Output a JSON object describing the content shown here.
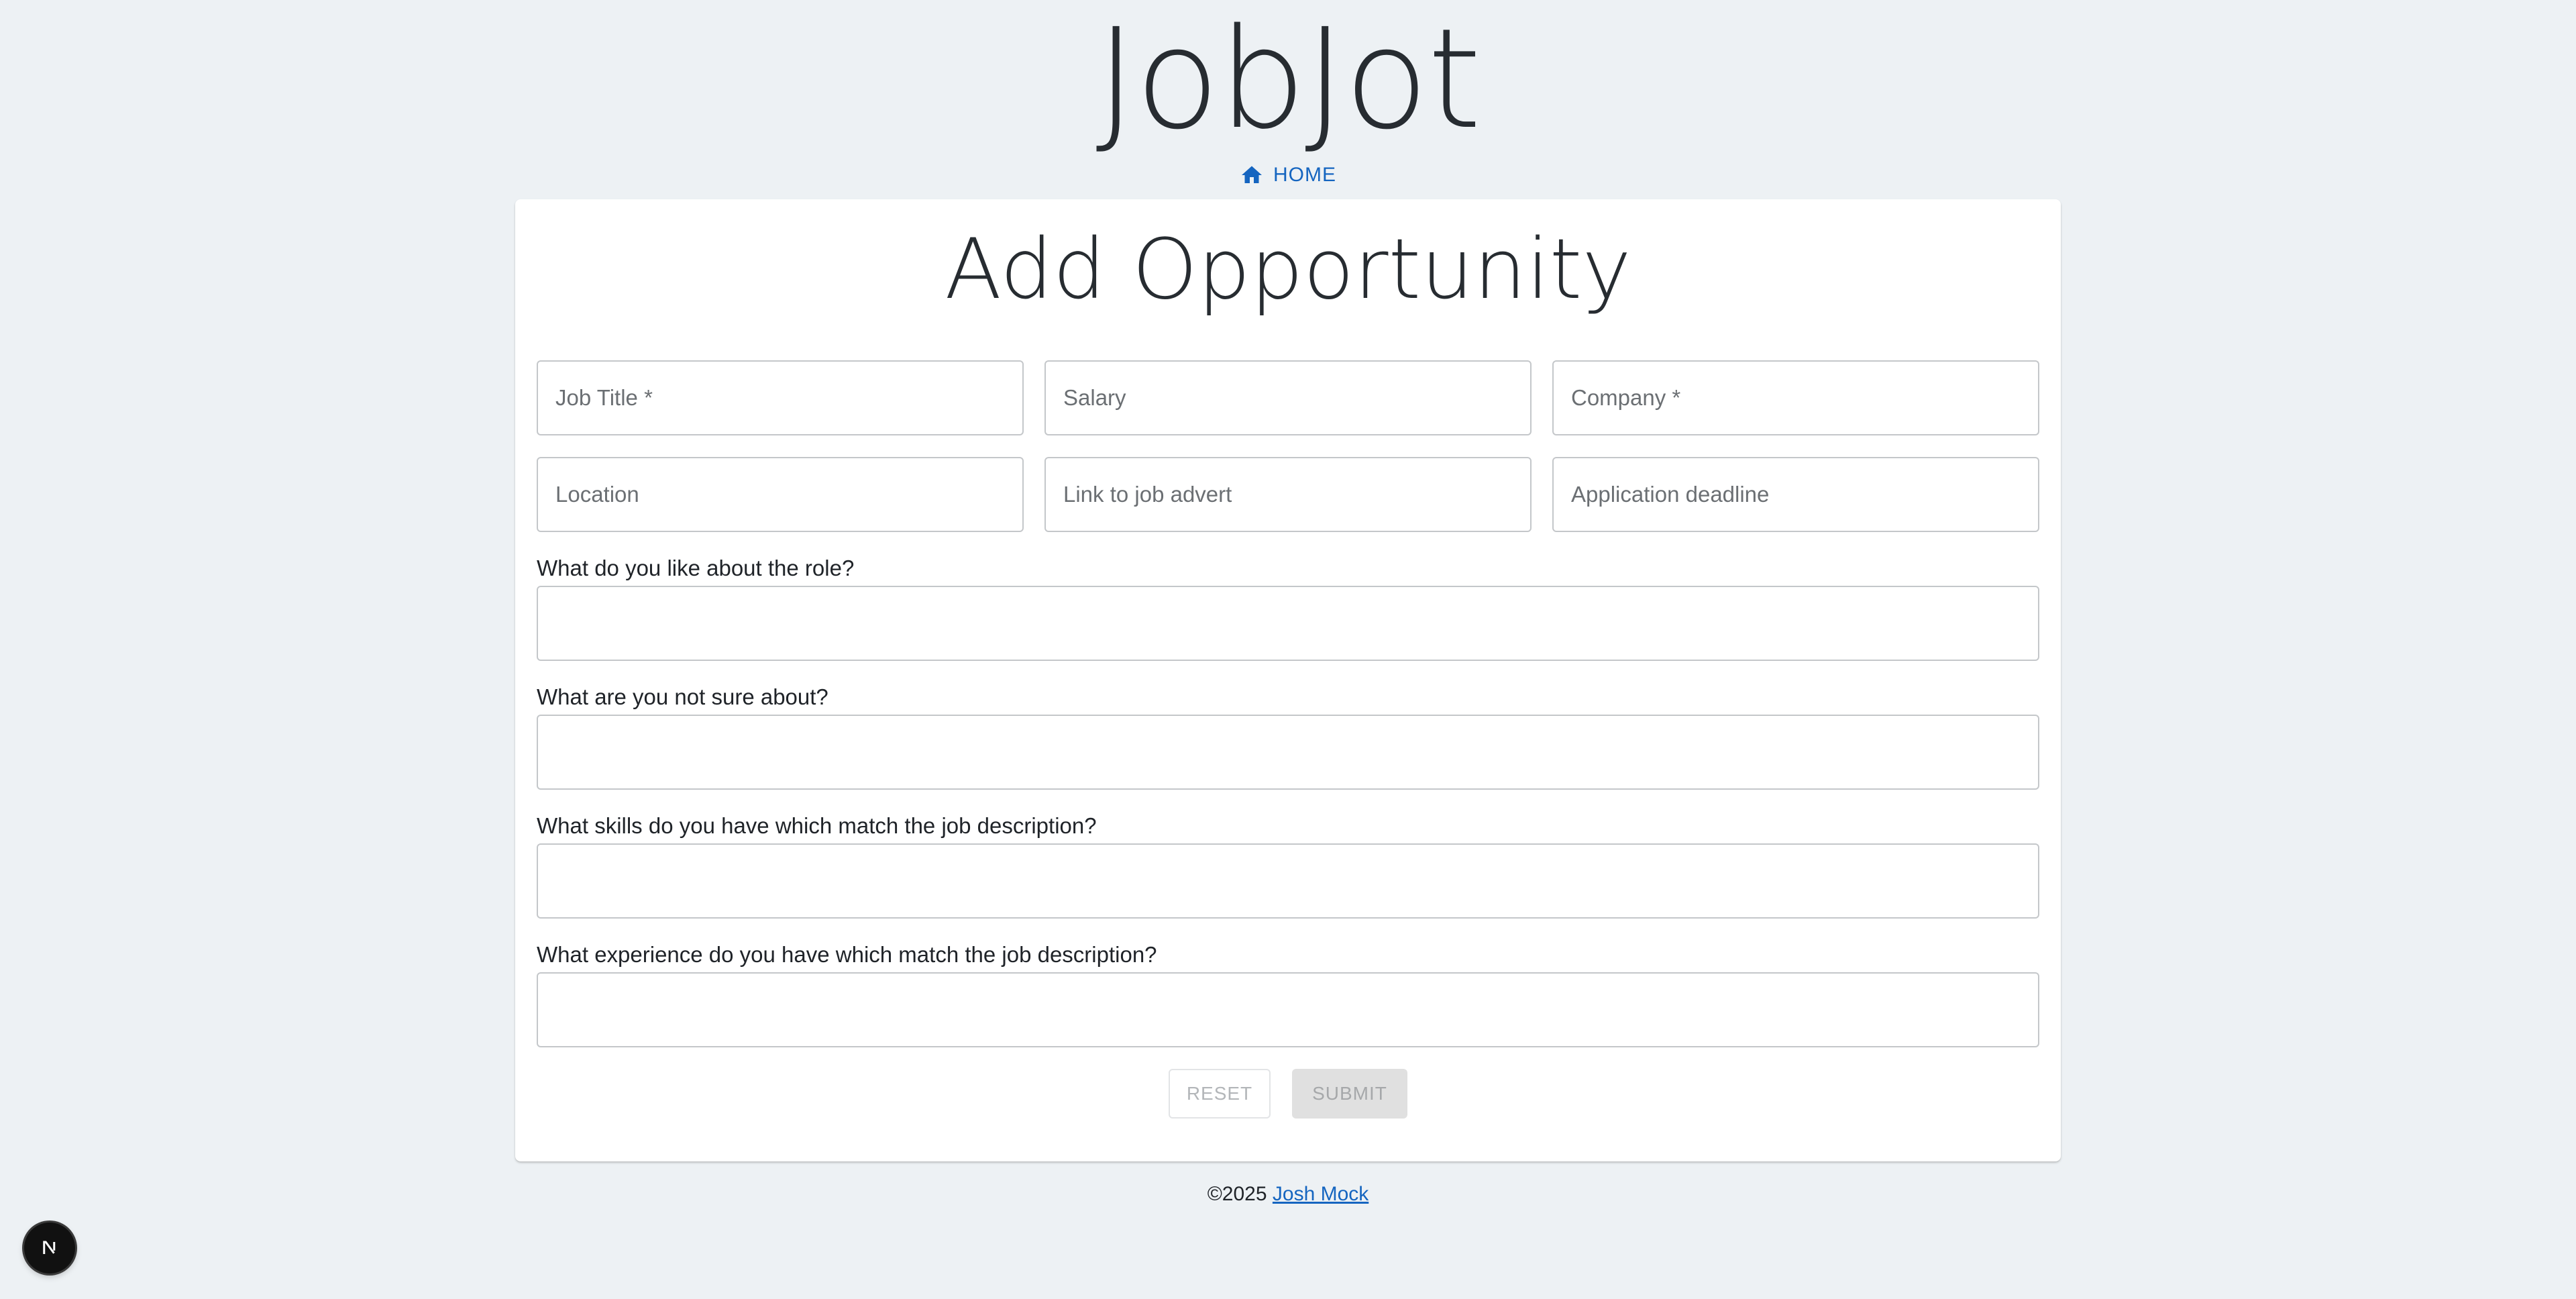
{
  "header": {
    "app_title": "JobJot",
    "home_link_label": "HOME",
    "home_icon": "home-icon"
  },
  "form": {
    "title": "Add Opportunity",
    "fields": {
      "job_title": {
        "placeholder": "Job Title *",
        "value": ""
      },
      "salary": {
        "placeholder": "Salary",
        "value": ""
      },
      "company": {
        "placeholder": "Company *",
        "value": ""
      },
      "location": {
        "placeholder": "Location",
        "value": ""
      },
      "job_advert_link": {
        "placeholder": "Link to job advert",
        "value": ""
      },
      "application_deadline": {
        "placeholder": "Application deadline",
        "value": ""
      }
    },
    "questions": {
      "likes_label": "What do you like about the role?",
      "unsure_label": "What are you not sure about?",
      "skills_label": "What skills do you have which match the job description?",
      "experience_label": "What experience do you have which match the job description?"
    },
    "buttons": {
      "reset_label": "RESET",
      "submit_label": "SUBMIT"
    }
  },
  "footer": {
    "copyright": "©2025",
    "author_link": "Josh Mock"
  },
  "dev_badge": {
    "icon": "nextjs-icon",
    "letter": "N"
  },
  "colors": {
    "background": "#edf1f4",
    "card": "#ffffff",
    "link": "#1565c0",
    "text": "#1f2328",
    "submit_disabled_bg": "#e0e0e0"
  }
}
